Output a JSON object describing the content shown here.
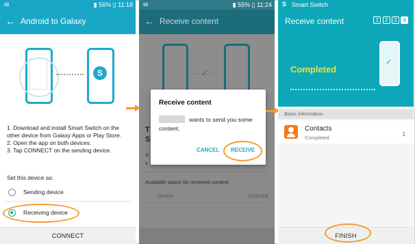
{
  "colors": {
    "teal": "#19a7c7",
    "accent_green": "#1ba87f",
    "highlight": "#f49a2e",
    "completed": "#e7e53a"
  },
  "screen1": {
    "status": {
      "battery": "56%",
      "time": "11:18"
    },
    "title": "Android to Galaxy",
    "instructions": [
      "1. Download and install Smart Switch on the other device from Galaxy Apps or Play Store.",
      "2. Open the app on both devices.",
      "3. Tap CONNECT on the sending device."
    ],
    "set_label": "Set this device as:",
    "options": [
      "Sending device",
      "Receiving device"
    ],
    "connect": "CONNECT"
  },
  "screen2": {
    "status": {
      "battery": "55%",
      "time": "11:24"
    },
    "title": "Receive content",
    "dialog": {
      "title": "Receive content",
      "message": "wants to send you some content.",
      "cancel": "CANCEL",
      "receive": "RECEIVE"
    },
    "bg_title_fragment": "T",
    "bg_title_fragment2": "S",
    "bg_line_fragments": [
      "S",
      "s"
    ],
    "available_label": "Available space for received content",
    "device_label": "Device",
    "device_value": "23.82GB"
  },
  "screen3": {
    "app_label": "Smart Switch",
    "title": "Receive content",
    "steps": [
      "1",
      "2",
      "3",
      "4"
    ],
    "completed": "Completed",
    "section": "Basic information",
    "item": {
      "name": "Contacts",
      "status": "Completed",
      "count": "1"
    },
    "finish": "FINISH"
  }
}
